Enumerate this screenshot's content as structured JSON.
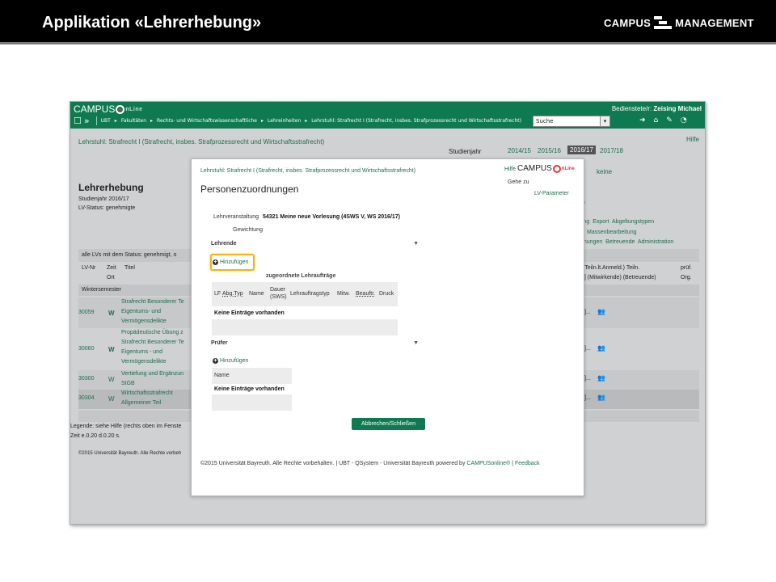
{
  "slide": {
    "title": "Applikation «Lehrerhebung»",
    "logo_left": "CAMPUS",
    "logo_right": "MANAGEMENT"
  },
  "topbar": {
    "brand": "CAMPUS",
    "brand_suffix": "nLine",
    "user_label": "Bedienstete/r:",
    "user_name": "Zeising Michael",
    "nav_items": [
      "UBT",
      "Fakultäten",
      "Rechts- und Wirtschaftswissenschaftliche",
      "Lehreinheiten",
      "Lehrstuhl: Strafrecht I (Strafrecht, insbes. Strafprozessrecht und Wirtschaftsstrafrecht)"
    ],
    "search_value": "Suche"
  },
  "background": {
    "breadcrumb": "Lehrstuhl: Strafrecht I (Strafrecht, insbes. Strafprozessrecht und Wirtschaftsstrafrecht)",
    "help": "Hilfe",
    "studienjahr_label": "Studienjahr",
    "years": [
      "2014/15",
      "2015/16",
      "2016/17",
      "2017/18"
    ],
    "keine": "keine",
    "heading": "Lehrerhebung",
    "studienjahr": "Studienjahr 2016/17",
    "lv_status": "LV-Status: genehmigte",
    "filter_text": "alle LVs mit dem Status: genehmigt, o",
    "col_lvnr": "LV-Nr",
    "col_zeit": "Zeit",
    "col_ort": "Ort",
    "col_titel": "Titel",
    "semester": "Wintersemester",
    "right_links_1": [
      "ting",
      "Export",
      "Abgeltungstypen"
    ],
    "right_links_2": "Massenbearbeitung",
    "right_links_3": [
      "dnungen",
      "Betreuende",
      "Administration"
    ],
    "right_ten": "ten",
    "right_col_1": "/ (Teiln.lt.Anmeld.) Teiln.",
    "right_col_2": ". ] (Mitwirkende) (Betreuende)",
    "right_pruef": "prüf.",
    "right_org": "Org.",
    "ellipsis": "]...",
    "rows": [
      {
        "nr": "30059",
        "w": "W",
        "lines": [
          "Strafrecht Besonderer Te",
          "Eigentums- und",
          "Vermögensdelikte"
        ]
      },
      {
        "nr": "30060",
        "w": "W",
        "lines": [
          "Propädeutische Übung z",
          "Strafrecht Besonderer Te",
          "Eigentums - und",
          "Vermögensdelikte"
        ]
      },
      {
        "nr": "30300",
        "w": "W",
        "lines": [
          "Vertiefung und Ergänzun",
          "StGB"
        ]
      },
      {
        "nr": "30304",
        "w": "W",
        "lines": [
          "Wirtschaftsstrafrecht",
          "Allgemeiner Teil"
        ]
      }
    ],
    "legend": "Legende: siehe Hilfe (rechts oben im Fenste",
    "zeit": "Zeit e.0.20 d.0.20 s.",
    "copyright": "©2015 Universität Bayreuth. Alle Rechte vorbeh"
  },
  "dialog": {
    "breadcrumb": "Lehrstuhl: Strafrecht I (Strafrecht, insbes. Strafprozessrecht und Wirtschaftsstrafrecht)",
    "help": "Hilfe",
    "logo": "CAMPUS",
    "logo_suffix": "nLine",
    "goto": "Gehe zu",
    "lv_parameter": "LV-Parameter",
    "title": "Personenzuordnungen",
    "lv_label": "Lehrveranstaltung",
    "lv_value": "54321 Meine neue Vorlesung (4SWS V, WS 2016/17)",
    "gewichtung": "Gewichtung",
    "section_lehrende": "Lehrende",
    "add_label": "Hinzufügen",
    "sub_heading": "zugeordnete Lehraufträge",
    "columns": [
      "LF",
      "Abg.Typ",
      "Name",
      "Dauer (SWS)",
      "Lehrauftragstyp",
      "Mitw.",
      "Beauftr.",
      "Druck"
    ],
    "empty": "Keine Einträge vorhanden",
    "section_pruefer": "Prüfer",
    "add_label_2": "Hinzufügen",
    "col_name": "Name",
    "empty_2": "Keine Einträge vorhanden",
    "close_button": "Abbrechen/Schließen",
    "footer_text": "©2015 Universität Bayreuth. Alle Rechte vorbehalten. | UBT - QSystem - Universität Bayreuth powered by",
    "footer_link": "CAMPUSonline®",
    "footer_sep": "|",
    "footer_feedback": "Feedback"
  }
}
